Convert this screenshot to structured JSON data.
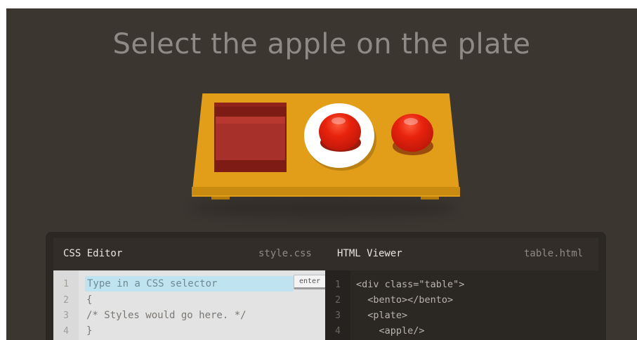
{
  "level": {
    "instruction": "Select the apple on the plate"
  },
  "editor": {
    "css": {
      "title": "CSS Editor",
      "filename": "style.css",
      "input_placeholder": "Type in a CSS selector",
      "enter_label": "enter",
      "lines": [
        {
          "num": "1",
          "text": ""
        },
        {
          "num": "2",
          "text": "{"
        },
        {
          "num": "3",
          "text": "/* Styles would go here. */"
        },
        {
          "num": "4",
          "text": "}"
        }
      ]
    },
    "html": {
      "title": "HTML Viewer",
      "filename": "table.html",
      "lines": [
        {
          "num": "1",
          "text": "<div class=\"table\">"
        },
        {
          "num": "2",
          "text": "  <bento></bento>"
        },
        {
          "num": "3",
          "text": "  <plate>"
        },
        {
          "num": "4",
          "text": "    <apple/>"
        }
      ]
    }
  },
  "colors": {
    "background": "#3b3630",
    "table": "#e39e19",
    "bento": "#a7302a",
    "apple": "#e8230d",
    "input_highlight": "#bfe3f1"
  }
}
